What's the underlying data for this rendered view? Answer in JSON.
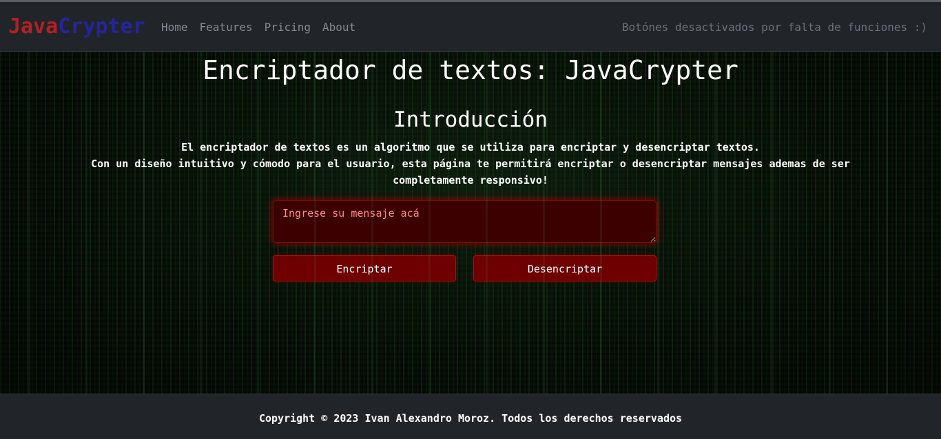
{
  "navbar": {
    "brand_part1": "Java",
    "brand_part2": "Crypter",
    "links": [
      "Home",
      "Features",
      "Pricing",
      "About"
    ],
    "note": "Botónes desactivados por falta de funciones :)"
  },
  "main": {
    "title": "Encriptador de textos: JavaCrypter",
    "subtitle": "Introducción",
    "intro_line1": "El encriptador de textos es un algoritmo que se utiliza para encriptar y desencriptar textos.",
    "intro_line2": "Con un diseño intuitivo y cómodo para el usuario, esta página te permitirá encriptar o desencriptar mensajes ademas de ser completamente responsivo!",
    "input_placeholder": "Ingrese su mensaje acá",
    "input_value": "",
    "encrypt_label": "Encriptar",
    "decrypt_label": "Desencriptar"
  },
  "footer": {
    "copyright": "Copyright © 2023 Ivan Alexandro Moroz. Todos los derechos reservados"
  },
  "colors": {
    "brand_java": "#b22025",
    "brand_crypter": "#25259a",
    "navbar_bg": "#212529",
    "button_bg": "#6e0002",
    "input_bg": "#3d0001"
  }
}
